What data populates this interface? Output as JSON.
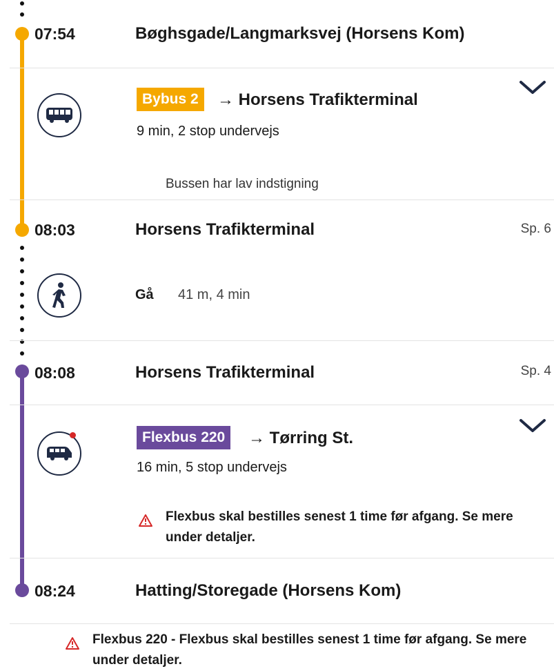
{
  "colors": {
    "bybus": "#f5a800",
    "flexbus": "#6a4a9c",
    "warning": "#d62828",
    "icon_border": "#1f2a44"
  },
  "stops": [
    {
      "time": "07:54",
      "name": "Bøghsgade/Langmarksvej (Horsens Kom)",
      "platform": ""
    },
    {
      "time": "08:03",
      "name": "Horsens Trafikterminal",
      "platform": "Sp. 6"
    },
    {
      "time": "08:08",
      "name": "Horsens Trafikterminal",
      "platform": "Sp. 4"
    },
    {
      "time": "08:24",
      "name": "Hatting/Storegade (Horsens Kom)",
      "platform": ""
    }
  ],
  "legs": {
    "bus": {
      "icon": "bus-icon",
      "line": "Bybus 2",
      "destination": "→ Horsens Trafikterminal",
      "duration": "9 min, 2 stop undervejs",
      "note": "Bussen har lav indstigning"
    },
    "walk": {
      "icon": "walk-icon",
      "label": "Gå",
      "detail": "41 m, 4 min"
    },
    "flex": {
      "icon": "flexbus-icon",
      "line": "Flexbus 220",
      "destination": "→ Tørring St.",
      "duration": "16 min, 5 stop undervejs",
      "warning": "Flexbus skal bestilles senest 1 time før afgang. Se mere under detaljer."
    }
  },
  "footer_warning": "Flexbus 220 - Flexbus skal bestilles senest 1 time før afgang. Se mere under detaljer."
}
